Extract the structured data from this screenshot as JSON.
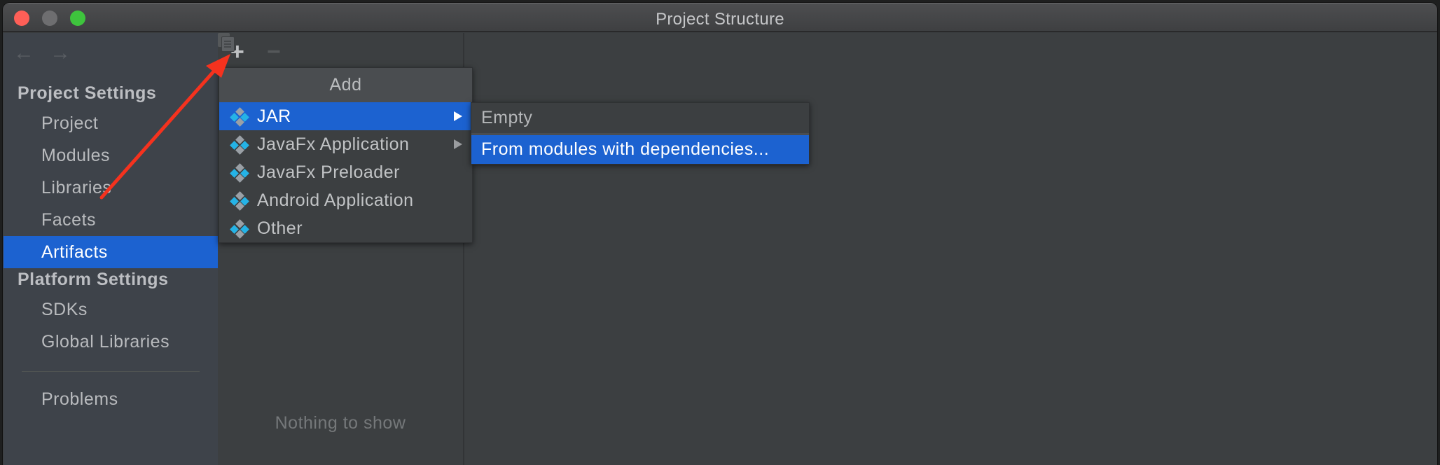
{
  "window": {
    "title": "Project Structure",
    "controls": [
      "close",
      "minimize",
      "maximize"
    ]
  },
  "sidebar": {
    "nav": {
      "back_icon": "←",
      "forward_icon": "→"
    },
    "sections": [
      {
        "heading": "Project Settings",
        "items": [
          {
            "label": "Project",
            "selected": false
          },
          {
            "label": "Modules",
            "selected": false
          },
          {
            "label": "Libraries",
            "selected": false
          },
          {
            "label": "Facets",
            "selected": false
          },
          {
            "label": "Artifacts",
            "selected": true
          }
        ]
      },
      {
        "heading": "Platform Settings",
        "items": [
          {
            "label": "SDKs",
            "selected": false
          },
          {
            "label": "Global Libraries",
            "selected": false
          }
        ]
      }
    ],
    "footer_items": [
      {
        "label": "Problems",
        "selected": false
      }
    ]
  },
  "toolbar": {
    "add_icon": "+",
    "remove_icon": "−",
    "copy_icon": "copy-icon"
  },
  "artifacts_panel": {
    "empty_text": "Nothing to show"
  },
  "add_menu": {
    "header": "Add",
    "items": [
      {
        "label": "JAR",
        "icon": "artifact-icon",
        "has_submenu": true,
        "selected": true
      },
      {
        "label": "JavaFx Application",
        "icon": "artifact-icon",
        "has_submenu": true,
        "selected": false
      },
      {
        "label": "JavaFx Preloader",
        "icon": "artifact-icon",
        "has_submenu": false,
        "selected": false
      },
      {
        "label": "Android Application",
        "icon": "artifact-icon",
        "has_submenu": false,
        "selected": false
      },
      {
        "label": "Other",
        "icon": "artifact-icon",
        "has_submenu": false,
        "selected": false
      }
    ]
  },
  "jar_submenu": {
    "items": [
      {
        "label": "Empty",
        "selected": false
      },
      {
        "label": "From modules with dependencies...",
        "selected": true
      }
    ]
  },
  "annotation": {
    "type": "arrow",
    "color": "#f5321e",
    "points_to": "toolbar add button"
  },
  "colors": {
    "selection": "#1c62d0",
    "icon_cyan": "#25b3e6",
    "icon_gray": "#9aa0a6"
  }
}
